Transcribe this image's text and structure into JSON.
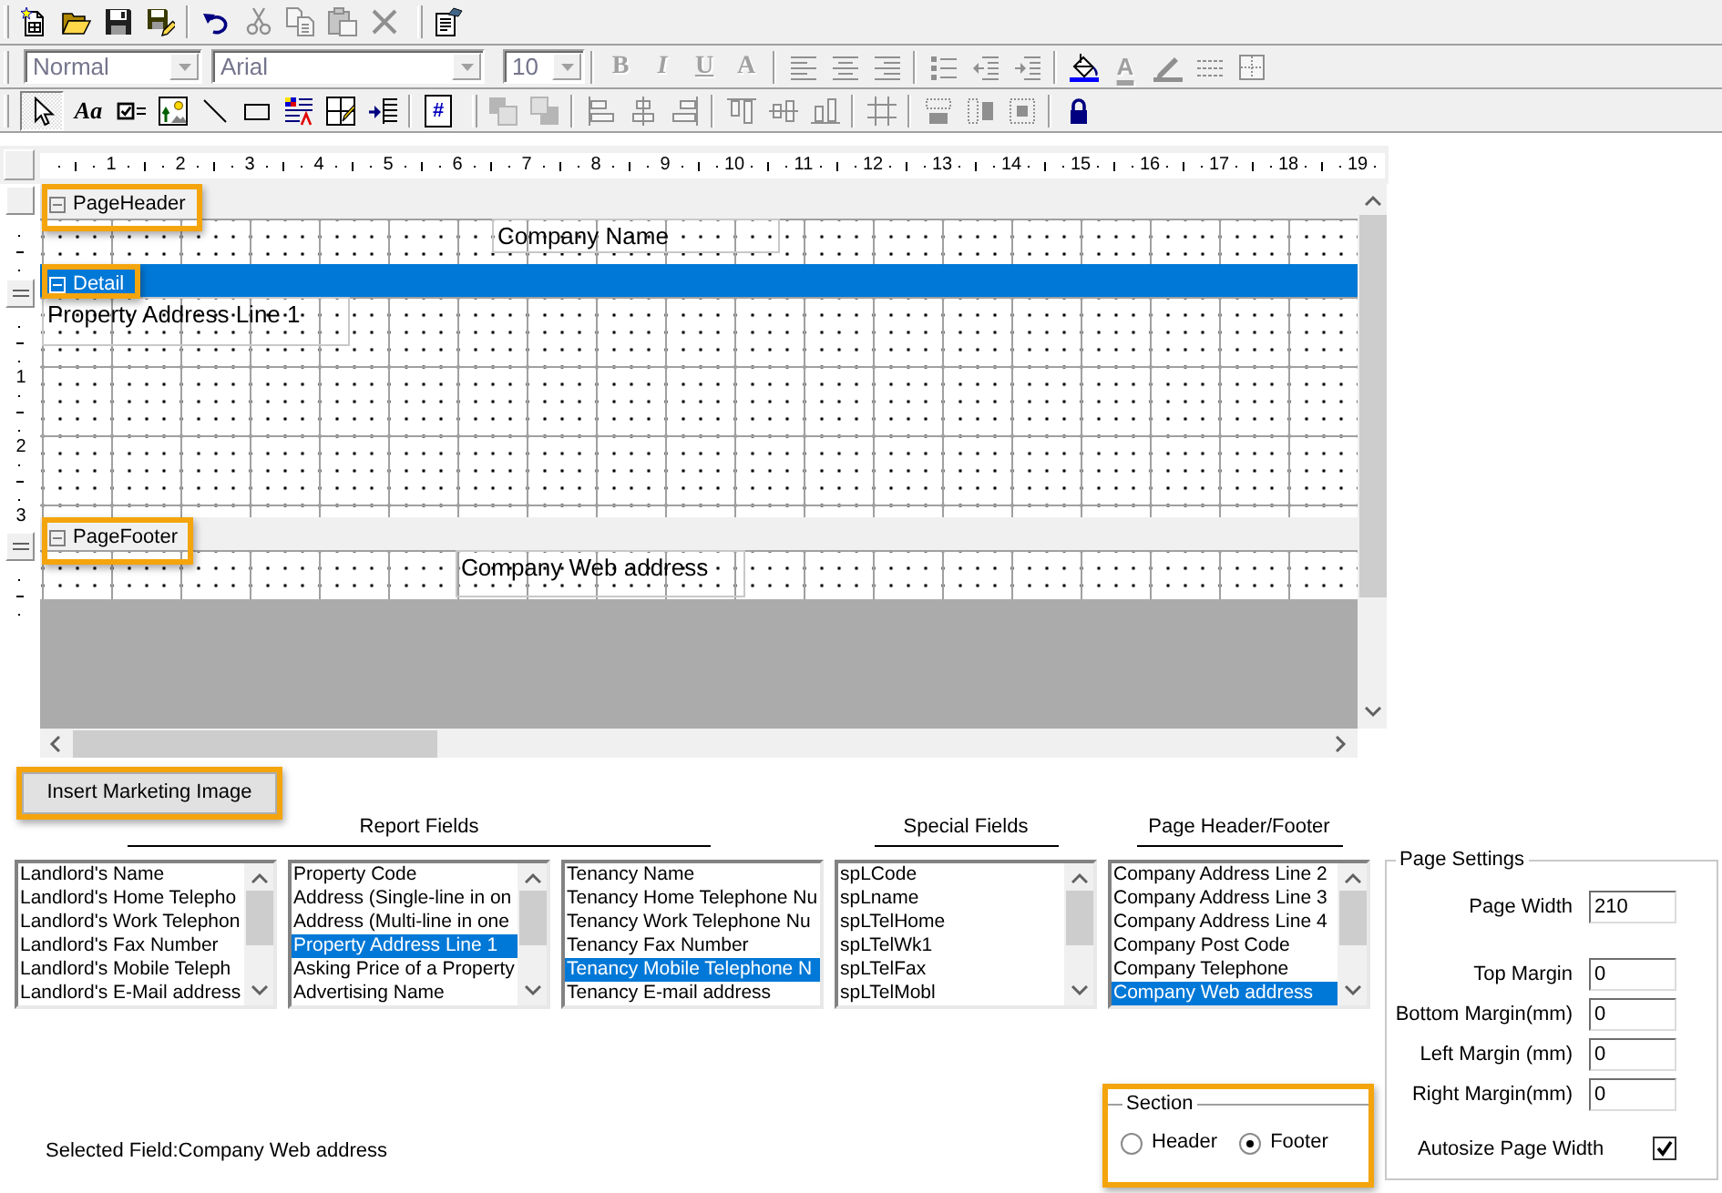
{
  "toolbar_rows": [
    {
      "toolbars": [
        {
          "groups": [
            [
              {
                "kind": "new",
                "disabled": false
              },
              {
                "kind": "open",
                "disabled": false
              },
              {
                "kind": "save",
                "disabled": false
              },
              {
                "kind": "saveas",
                "disabled": false
              }
            ],
            [
              {
                "kind": "undo",
                "disabled": false
              },
              {
                "kind": "cut",
                "disabled": true
              },
              {
                "kind": "copy",
                "disabled": true
              },
              {
                "kind": "paste",
                "disabled": true
              },
              {
                "kind": "delete",
                "disabled": true
              }
            ]
          ]
        },
        {
          "groups": [
            [
              {
                "kind": "properties",
                "disabled": false
              }
            ]
          ]
        }
      ]
    },
    {
      "toolbars": [
        {
          "groups": [
            [
              {
                "kind": "style",
                "value": "Normal",
                "disabled": true
              },
              {
                "kind": "font",
                "value": "Arial",
                "disabled": true
              },
              {
                "kind": "size",
                "value": "10",
                "disabled": true
              }
            ],
            [
              {
                "kind": "bold",
                "label": "B",
                "disabled": true
              },
              {
                "kind": "italic",
                "label": "I",
                "disabled": true
              },
              {
                "kind": "underline",
                "label": "U",
                "disabled": true
              },
              {
                "kind": "letter",
                "label": "A",
                "disabled": true
              }
            ],
            [
              {
                "kind": "alignleft",
                "disabled": true
              },
              {
                "kind": "center",
                "disabled": true
              },
              {
                "kind": "alignright",
                "disabled": true
              }
            ],
            [
              {
                "kind": "bullets",
                "disabled": true
              },
              {
                "kind": "outdent",
                "disabled": true
              },
              {
                "kind": "indent",
                "disabled": true
              }
            ],
            [
              {
                "kind": "fill",
                "disabled": false
              },
              {
                "kind": "fontcolor",
                "label": "A",
                "disabled": true
              },
              {
                "kind": "linecolor",
                "disabled": true
              },
              {
                "kind": "linestyle",
                "disabled": true
              },
              {
                "kind": "border",
                "disabled": true
              }
            ]
          ]
        }
      ]
    },
    {
      "toolbars": [
        {
          "groups": [
            [
              {
                "kind": "pointer",
                "selected": true,
                "disabled": false
              },
              {
                "kind": "label",
                "label": "Aa",
                "selected": false,
                "disabled": false
              },
              {
                "kind": "checkbox",
                "selected": false,
                "disabled": false
              },
              {
                "kind": "picture",
                "selected": false,
                "disabled": false
              },
              {
                "kind": "line",
                "selected": false,
                "disabled": false
              },
              {
                "kind": "rect",
                "selected": false,
                "disabled": false
              },
              {
                "kind": "richtext",
                "selected": false,
                "disabled": false
              },
              {
                "kind": "subreport",
                "selected": false,
                "disabled": false
              },
              {
                "kind": "list",
                "selected": false,
                "disabled": false
              }
            ],
            [
              {
                "kind": "pagenumber",
                "label": "#",
                "disabled": false
              }
            ]
          ]
        },
        {
          "groups": [
            [
              {
                "kind": "front",
                "disabled": true
              },
              {
                "kind": "back",
                "disabled": true
              }
            ],
            [
              {
                "kind": "lefts",
                "disabled": true
              },
              {
                "kind": "centers",
                "disabled": true
              },
              {
                "kind": "rights",
                "disabled": true
              }
            ],
            [
              {
                "kind": "tops",
                "disabled": true
              },
              {
                "kind": "middles",
                "disabled": true
              },
              {
                "kind": "bottoms",
                "disabled": true
              }
            ],
            [
              {
                "kind": "sizegrid",
                "disabled": true
              }
            ],
            [
              {
                "kind": "samewidth",
                "disabled": true
              },
              {
                "kind": "sameheight",
                "disabled": true
              },
              {
                "kind": "samesize",
                "disabled": true
              }
            ],
            [
              {
                "kind": "lock",
                "disabled": false
              }
            ]
          ]
        }
      ]
    }
  ],
  "designer": {
    "ruler_labels": [
      "1",
      "2",
      "3",
      "4",
      "5",
      "6",
      "7",
      "8",
      "9",
      "10",
      "11",
      "12",
      "13",
      "14",
      "15",
      "16",
      "17",
      "18",
      "19"
    ],
    "sections": [
      {
        "title": "PageHeader",
        "expanded": true,
        "selected": false,
        "highlighted": true,
        "fields": [
          {
            "text": "Company Name"
          }
        ]
      },
      {
        "title": "Detail",
        "expanded": true,
        "selected": true,
        "highlighted": true,
        "ruler_labels": [
          "1",
          "2",
          "3"
        ],
        "fields": [
          {
            "text": "Property Address Line 1"
          }
        ]
      },
      {
        "title": "PageFooter",
        "expanded": true,
        "selected": false,
        "highlighted": true,
        "fields": [
          {
            "text": "Company Web address"
          }
        ]
      }
    ]
  },
  "insert_button": {
    "label": "Insert Marketing Image",
    "highlighted": true
  },
  "field_groups": [
    {
      "heading": "Report Fields",
      "lists": [
        {
          "scrollbar": true,
          "items": [
            {
              "text": "Landlord's Name",
              "selected": false
            },
            {
              "text": "Landlord's Home Telepho",
              "selected": false
            },
            {
              "text": "Landlord's Work Telephon",
              "selected": false
            },
            {
              "text": "Landlord's Fax Number",
              "selected": false
            },
            {
              "text": "Landlord's Mobile Teleph",
              "selected": false
            },
            {
              "text": "Landlord's E-Mail address",
              "selected": false
            }
          ]
        },
        {
          "scrollbar": true,
          "items": [
            {
              "text": "Property Code",
              "selected": false
            },
            {
              "text": "Address (Single-line in on",
              "selected": false
            },
            {
              "text": "Address (Multi-line in one",
              "selected": false
            },
            {
              "text": "Property Address Line 1",
              "selected": true
            },
            {
              "text": "Asking Price of a Property",
              "selected": false
            },
            {
              "text": "Advertising Name",
              "selected": false
            }
          ]
        },
        {
          "scrollbar": false,
          "items": [
            {
              "text": "Tenancy Name",
              "selected": false
            },
            {
              "text": "Tenancy Home Telephone Nu",
              "selected": false
            },
            {
              "text": "Tenancy Work Telephone Nu",
              "selected": false
            },
            {
              "text": "Tenancy Fax Number",
              "selected": false
            },
            {
              "text": "Tenancy Mobile Telephone N",
              "selected": true
            },
            {
              "text": "Tenancy E-mail address",
              "selected": false
            }
          ]
        }
      ]
    },
    {
      "heading": "Special Fields",
      "lists": [
        {
          "scrollbar": true,
          "items": [
            {
              "text": "spLCode",
              "selected": false
            },
            {
              "text": "spLname",
              "selected": false
            },
            {
              "text": "spLTelHome",
              "selected": false
            },
            {
              "text": "spLTelWk1",
              "selected": false
            },
            {
              "text": "spLTelFax",
              "selected": false
            },
            {
              "text": "spLTelMobl",
              "selected": false
            }
          ]
        }
      ]
    },
    {
      "heading": "Page Header/Footer",
      "lists": [
        {
          "scrollbar": true,
          "items": [
            {
              "text": "Company Address Line 2",
              "selected": false
            },
            {
              "text": "Company Address Line 3",
              "selected": false
            },
            {
              "text": "Company Address Line 4",
              "selected": false
            },
            {
              "text": "Company Post Code",
              "selected": false
            },
            {
              "text": "Company Telephone",
              "selected": false
            },
            {
              "text": "Company Web address",
              "selected": true
            }
          ]
        }
      ]
    }
  ],
  "selected_field": "Selected Field:Company Web address",
  "section_choice": {
    "title": "Section",
    "highlighted": true,
    "options": [
      {
        "label": "Header",
        "selected": false
      },
      {
        "label": "Footer",
        "selected": true
      }
    ]
  },
  "page_settings": {
    "title": "Page Settings",
    "fields": [
      {
        "label": "Page Width",
        "value": "210"
      },
      {
        "label": "Top Margin",
        "value": "0"
      },
      {
        "label": "Bottom Margin(mm)",
        "value": "0"
      },
      {
        "label": "Left Margin (mm)",
        "value": "0"
      },
      {
        "label": "Right Margin(mm)",
        "value": "0"
      }
    ],
    "autosize": {
      "label": "Autosize Page Width",
      "checked": true
    }
  }
}
